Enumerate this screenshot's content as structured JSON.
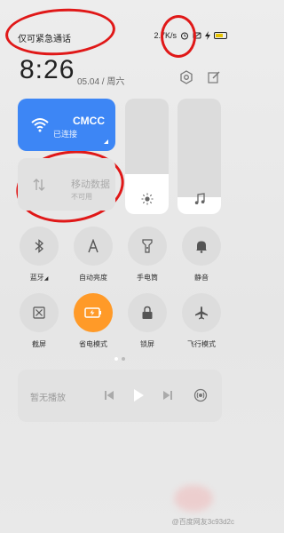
{
  "status_bar": {
    "carrier_text": "仅可紧急通话",
    "net_speed": "2.7K/s"
  },
  "header": {
    "time": "8:26",
    "date": "05.04 / 周六"
  },
  "wifi_tile": {
    "name": "CMCC",
    "status": "已连接"
  },
  "data_tile": {
    "name": "移动数据",
    "status": "不可用"
  },
  "sliders": {
    "brightness_level": 0.35,
    "volume_level": 0.15
  },
  "toggles": [
    {
      "label": "蓝牙",
      "icon": "bluetooth-icon",
      "active": false
    },
    {
      "label": "自动亮度",
      "icon": "auto-brightness-icon",
      "active": false
    },
    {
      "label": "手电筒",
      "icon": "flashlight-icon",
      "active": false
    },
    {
      "label": "静音",
      "icon": "bell-icon",
      "active": false
    },
    {
      "label": "截屏",
      "icon": "screenshot-icon",
      "active": false
    },
    {
      "label": "省电模式",
      "icon": "battery-saver-icon",
      "active": true
    },
    {
      "label": "锁屏",
      "icon": "lock-icon",
      "active": false
    },
    {
      "label": "飞行模式",
      "icon": "airplane-icon",
      "active": false
    }
  ],
  "media": {
    "label": "暂无播放"
  },
  "watermark": "@百度网友3c93d2c",
  "colors": {
    "accent_blue": "#3d86f5",
    "accent_orange": "#ff9a28",
    "annotation_red": "#e01818"
  }
}
